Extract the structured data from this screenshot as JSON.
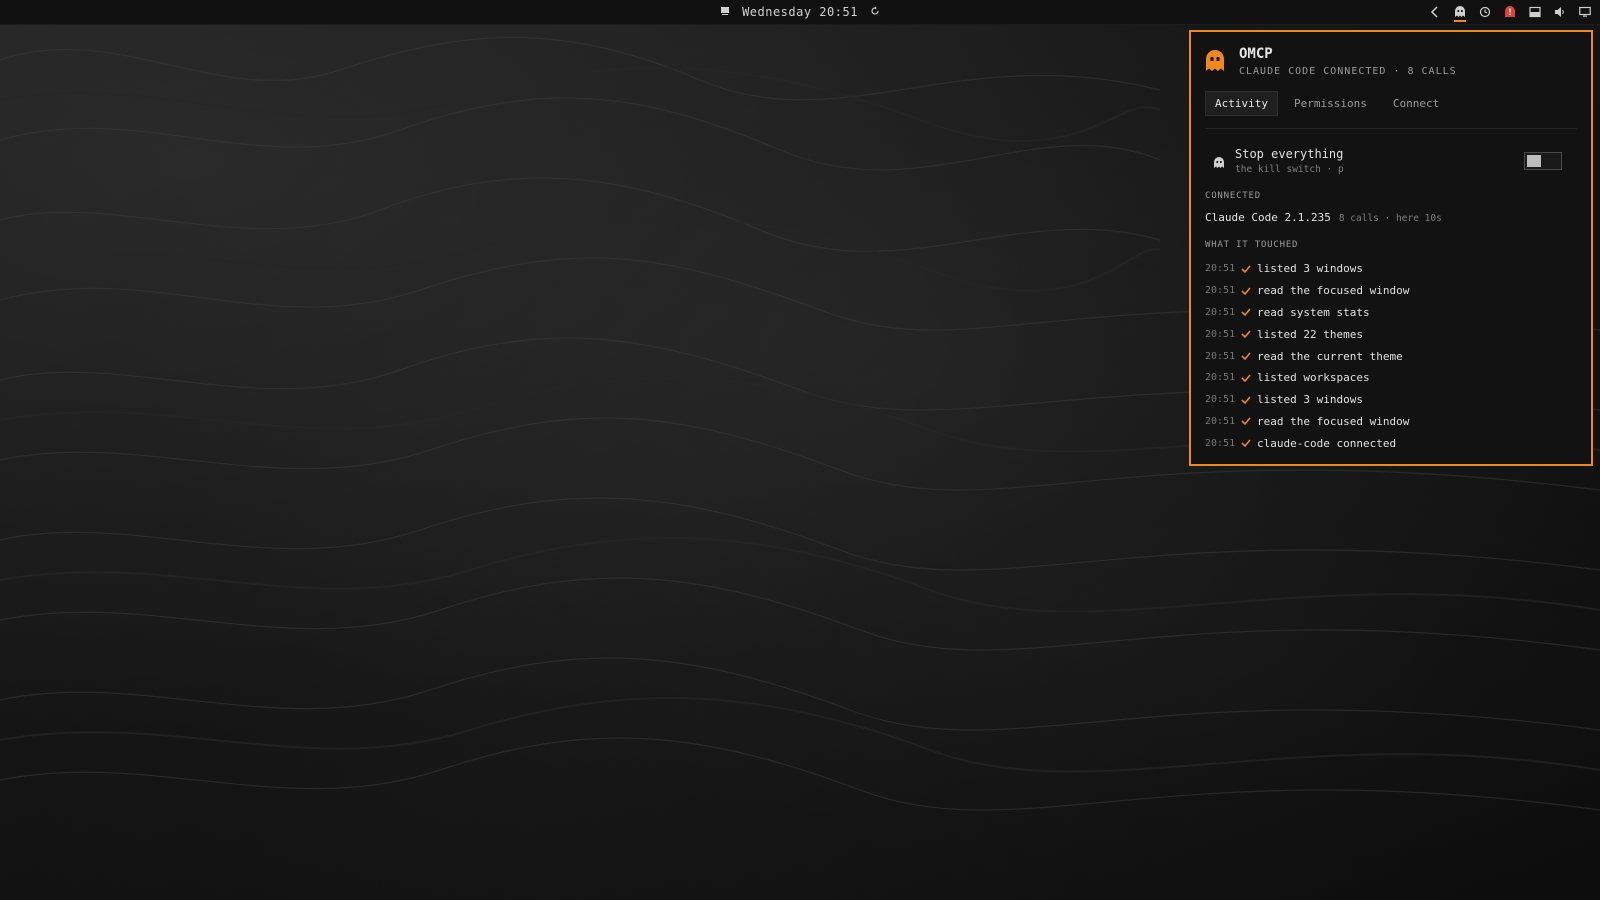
{
  "topbar": {
    "clock": "Wednesday 20:51",
    "icons": [
      "workspace-icon",
      "refresh-icon"
    ],
    "tray": [
      "chevron-left-icon",
      "ghost-icon",
      "history-icon",
      "alert-icon",
      "window-icon",
      "volume-icon",
      "display-icon"
    ]
  },
  "colors": {
    "accent": "#f0891a",
    "alert": "#e0413a",
    "panel_bg": "#121212"
  },
  "panel": {
    "title": "OMCP",
    "subtitle": "CLAUDE CODE CONNECTED · 8 CALLS",
    "tabs": [
      {
        "label": "Activity",
        "active": true
      },
      {
        "label": "Permissions",
        "active": false
      },
      {
        "label": "Connect",
        "active": false
      }
    ],
    "kill_switch": {
      "title": "Stop everything",
      "subtitle": "the kill switch · p",
      "enabled": false
    },
    "connected_label": "CONNECTED",
    "client": {
      "name": "Claude Code 2.1.235",
      "meta": "8 calls · here 10s"
    },
    "touched_label": "WHAT IT TOUCHED",
    "log": [
      {
        "time": "20:51",
        "text": "listed 3 windows"
      },
      {
        "time": "20:51",
        "text": "read the focused window"
      },
      {
        "time": "20:51",
        "text": "read system stats"
      },
      {
        "time": "20:51",
        "text": "listed 22 themes"
      },
      {
        "time": "20:51",
        "text": "read the current theme"
      },
      {
        "time": "20:51",
        "text": "listed workspaces"
      },
      {
        "time": "20:51",
        "text": "listed 3 windows"
      },
      {
        "time": "20:51",
        "text": "read the focused window"
      },
      {
        "time": "20:51",
        "text": "claude-code connected"
      }
    ]
  }
}
